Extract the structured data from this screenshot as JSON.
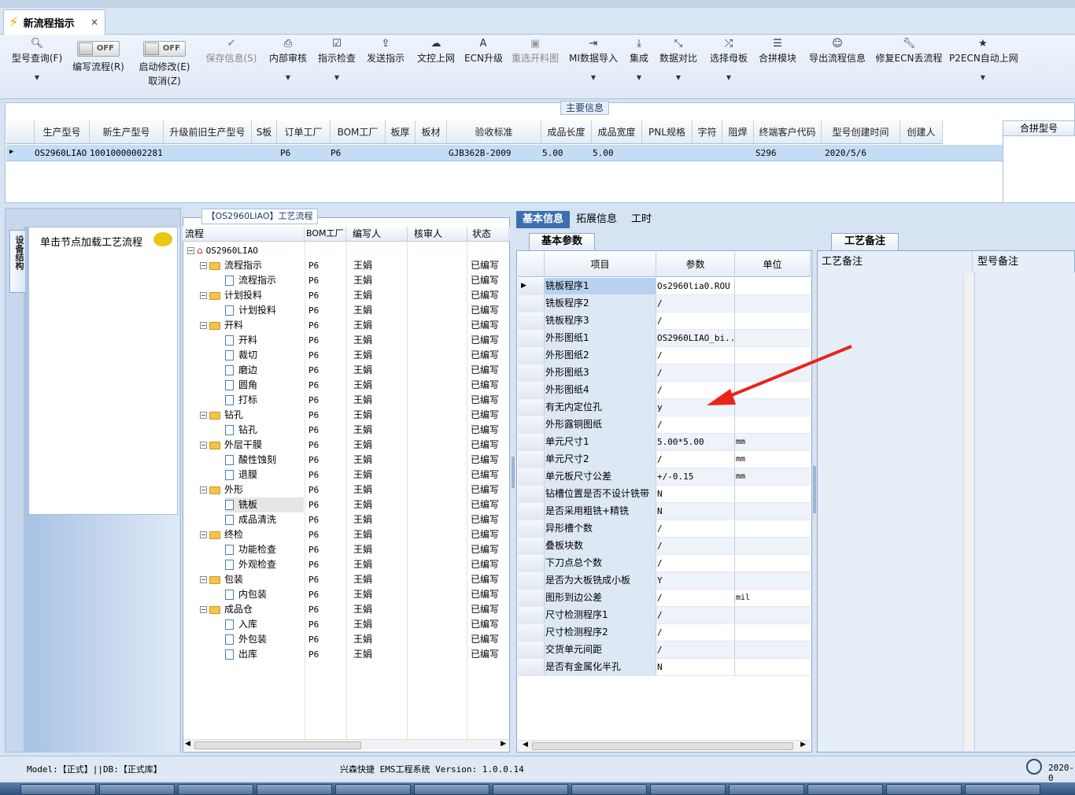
{
  "document_tab": {
    "title": "新流程指示",
    "close": "×"
  },
  "toolbar": {
    "model_query": "型号查询(F)",
    "write_flow_toggle": "OFF",
    "write_flow": "编写流程(R)",
    "start_modify_toggle": "OFF",
    "start_modify": "启动修改(E)",
    "cancel": "取消(Z)",
    "save_info": "保存信息(S)",
    "internal_review": "内部审核",
    "instruction_check": "指示检查",
    "send_instruction": "发送指示",
    "upload_doc": "文控上网",
    "ecn_upgrade": "ECN升级",
    "reselect_drawing": "重选开料图",
    "mi_import": "MI数据导入",
    "integrate": "集成",
    "data_compare": "数据对比",
    "select_mother_board": "选择母板",
    "combine_module": "合拼模块",
    "export_flow": "导出流程信息",
    "repair_ecn": "修复ECN丢流程",
    "p2ecn_auto": "P2ECN自动上网"
  },
  "main_info": {
    "label": "主要信息",
    "columns": [
      "生产型号",
      "新生产型号",
      "升级前旧生产型号",
      "S板",
      "订单工厂",
      "BOM工厂",
      "板厚",
      "板材",
      "验收标准",
      "成品长度",
      "成品宽度",
      "PNL规格",
      "字符",
      "阻焊",
      "终端客户代码",
      "型号创建时间",
      "创建人"
    ],
    "row": {
      "model": "OS2960LIAO",
      "new_model": "10010000002281",
      "old_model": "",
      "s_board": "",
      "order_factory": "P6",
      "bom_factory": "P6",
      "thickness": "",
      "material": "",
      "standard": "GJB362B-2009",
      "length": "5.00",
      "width": "5.00",
      "pnl": "",
      "char": "",
      "mask": "",
      "customer": "S296",
      "created": "2020/5/6",
      "creator": ""
    },
    "combine_header": "合拼型号"
  },
  "left_panel": {
    "vertical_tab": "设备结构",
    "hint": "单击节点加载工艺流程"
  },
  "process_tree": {
    "label": "【OS2960LIAO】工艺流程",
    "columns": [
      "流程",
      "BOM工厂",
      "编写人",
      "核审人",
      "状态"
    ],
    "root": "OS2960LIAO",
    "rows": [
      {
        "name": "流程指示",
        "folder": true,
        "factory": "P6",
        "writer": "王娟",
        "status": "已编写"
      },
      {
        "name": "流程指示",
        "folder": false,
        "factory": "P6",
        "writer": "王娟",
        "status": "已编写"
      },
      {
        "name": "计划投料",
        "folder": true,
        "factory": "P6",
        "writer": "王娟",
        "status": "已编写"
      },
      {
        "name": "计划投料",
        "folder": false,
        "factory": "P6",
        "writer": "王娟",
        "status": "已编写"
      },
      {
        "name": "开料",
        "folder": true,
        "factory": "P6",
        "writer": "王娟",
        "status": "已编写"
      },
      {
        "name": "开料",
        "folder": false,
        "factory": "P6",
        "writer": "王娟",
        "status": "已编写"
      },
      {
        "name": "裁切",
        "folder": false,
        "factory": "P6",
        "writer": "王娟",
        "status": "已编写"
      },
      {
        "name": "磨边",
        "folder": false,
        "factory": "P6",
        "writer": "王娟",
        "status": "已编写"
      },
      {
        "name": "圆角",
        "folder": false,
        "factory": "P6",
        "writer": "王娟",
        "status": "已编写"
      },
      {
        "name": "打标",
        "folder": false,
        "factory": "P6",
        "writer": "王娟",
        "status": "已编写"
      },
      {
        "name": "钻孔",
        "folder": true,
        "factory": "P6",
        "writer": "王娟",
        "status": "已编写"
      },
      {
        "name": "钻孔",
        "folder": false,
        "factory": "P6",
        "writer": "王娟",
        "status": "已编写"
      },
      {
        "name": "外层干膜",
        "folder": true,
        "factory": "P6",
        "writer": "王娟",
        "status": "已编写"
      },
      {
        "name": "酸性蚀刻",
        "folder": false,
        "factory": "P6",
        "writer": "王娟",
        "status": "已编写"
      },
      {
        "name": "退膜",
        "folder": false,
        "factory": "P6",
        "writer": "王娟",
        "status": "已编写"
      },
      {
        "name": "外形",
        "folder": true,
        "factory": "P6",
        "writer": "王娟",
        "status": "已编写"
      },
      {
        "name": "铣板",
        "folder": false,
        "factory": "P6",
        "writer": "王娟",
        "status": "已编写"
      },
      {
        "name": "成品清洗",
        "folder": false,
        "factory": "P6",
        "writer": "王娟",
        "status": "已编写"
      },
      {
        "name": "终检",
        "folder": true,
        "factory": "P6",
        "writer": "王娟",
        "status": "已编写"
      },
      {
        "name": "功能检查",
        "folder": false,
        "factory": "P6",
        "writer": "王娟",
        "status": "已编写"
      },
      {
        "name": "外观检查",
        "folder": false,
        "factory": "P6",
        "writer": "王娟",
        "status": "已编写"
      },
      {
        "name": "包装",
        "folder": true,
        "factory": "P6",
        "writer": "王娟",
        "status": "已编写"
      },
      {
        "name": "内包装",
        "folder": false,
        "factory": "P6",
        "writer": "王娟",
        "status": "已编写"
      },
      {
        "name": "成品仓",
        "folder": true,
        "factory": "P6",
        "writer": "王娟",
        "status": "已编写"
      },
      {
        "name": "入库",
        "folder": false,
        "factory": "P6",
        "writer": "王娟",
        "status": "已编写"
      },
      {
        "name": "外包装",
        "folder": false,
        "factory": "P6",
        "writer": "王娟",
        "status": "已编写"
      },
      {
        "name": "出库",
        "folder": false,
        "factory": "P6",
        "writer": "王娟",
        "status": "已编写"
      }
    ]
  },
  "right_tabs": {
    "basic": "基本信息",
    "extended": "拓展信息",
    "hours": "工时"
  },
  "params": {
    "subtab": "基本参数",
    "columns": [
      "项目",
      "参数",
      "单位"
    ],
    "rows": [
      {
        "item": "铣板程序1",
        "value": "Os2960lia0.ROU",
        "unit": ""
      },
      {
        "item": "铣板程序2",
        "value": "/",
        "unit": ""
      },
      {
        "item": "铣板程序3",
        "value": "/",
        "unit": ""
      },
      {
        "item": "外形图纸1",
        "value": "OS2960LIAO_bi...",
        "unit": ""
      },
      {
        "item": "外形图纸2",
        "value": "/",
        "unit": ""
      },
      {
        "item": "外形图纸3",
        "value": "/",
        "unit": ""
      },
      {
        "item": "外形图纸4",
        "value": "/",
        "unit": ""
      },
      {
        "item": "有无内定位孔",
        "value": "y",
        "unit": ""
      },
      {
        "item": "外形露铜图纸",
        "value": "/",
        "unit": ""
      },
      {
        "item": "单元尺寸1",
        "value": "5.00*5.00",
        "unit": "mm"
      },
      {
        "item": "单元尺寸2",
        "value": "/",
        "unit": "mm"
      },
      {
        "item": "单元板尺寸公差",
        "value": "+/-0.15",
        "unit": "mm"
      },
      {
        "item": "钻槽位置是否不设计铣带",
        "value": "N",
        "unit": ""
      },
      {
        "item": "是否采用粗铣+精铣",
        "value": "N",
        "unit": ""
      },
      {
        "item": "异形槽个数",
        "value": "/",
        "unit": ""
      },
      {
        "item": "叠板块数",
        "value": "/",
        "unit": ""
      },
      {
        "item": "下刀点总个数",
        "value": "/",
        "unit": ""
      },
      {
        "item": "是否为大板铣成小板",
        "value": "Y",
        "unit": ""
      },
      {
        "item": "图形到边公差",
        "value": "/",
        "unit": "mil"
      },
      {
        "item": "尺寸检测程序1",
        "value": "/",
        "unit": ""
      },
      {
        "item": "尺寸检测程序2",
        "value": "/",
        "unit": ""
      },
      {
        "item": "交货单元间距",
        "value": "/",
        "unit": ""
      },
      {
        "item": "是否有金属化半孔",
        "value": "N",
        "unit": ""
      }
    ]
  },
  "notes": {
    "tab": "工艺备注",
    "col1": "工艺备注",
    "col2": "型号备注"
  },
  "status_bar": {
    "model": "Model:【正式】||DB:【正式库】",
    "system": "兴森快捷 EMS工程系统 Version: 1.0.0.14",
    "date": "2020-0"
  },
  "colors": {
    "arrow": "#e8241c",
    "selection": "#c5dcf5",
    "tab_active": "#3d6fb0"
  }
}
